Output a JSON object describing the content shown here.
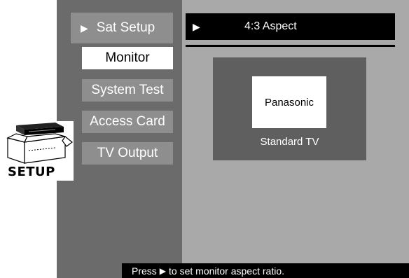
{
  "sidebar": {
    "items": [
      {
        "label": "Sat Setup",
        "arrow": "▶"
      },
      {
        "label": "Monitor"
      },
      {
        "label": "System Test"
      },
      {
        "label": "Access Card"
      },
      {
        "label": "TV Output"
      }
    ]
  },
  "header": {
    "arrow": "▶",
    "title": "4:3 Aspect"
  },
  "preview": {
    "brand": "Panasonic",
    "caption": "Standard TV"
  },
  "setup_icon": {
    "label": "SETUP"
  },
  "status": {
    "before": "Press",
    "arrow": "▶",
    "after": "to set monitor aspect ratio."
  },
  "colors": {
    "panel_dark": "#6b6b6b",
    "panel_light": "#a9a9a9",
    "item_bg": "#8e8e8e",
    "selected_bg": "#ffffff"
  }
}
